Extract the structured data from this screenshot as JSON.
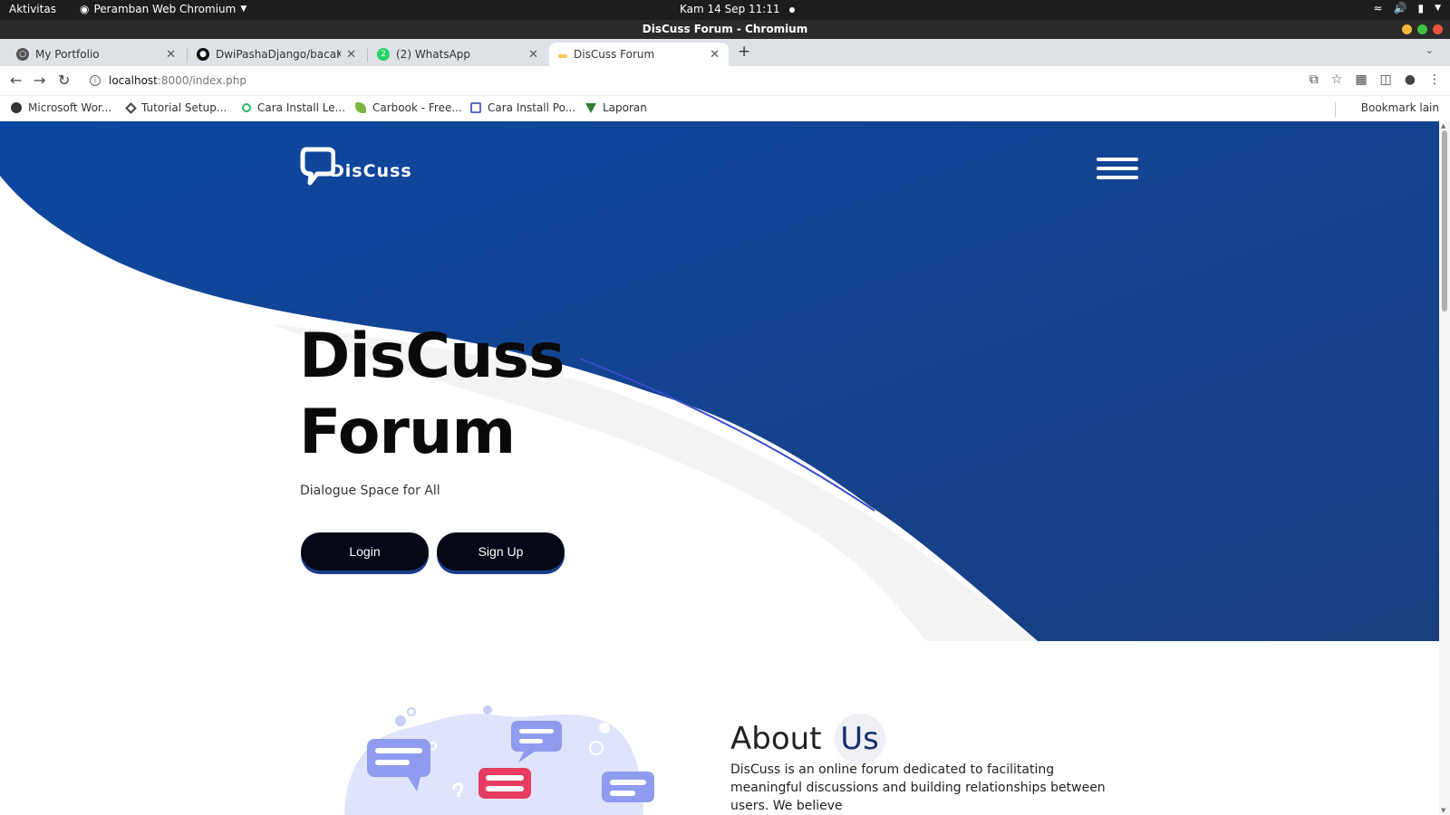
{
  "os": {
    "activities": "Aktivitas",
    "app_menu": "Peramban Web Chromium",
    "clock": "Kam 14 Sep  11:11"
  },
  "window": {
    "title": "DisCuss Forum - Chromium"
  },
  "tabs": [
    {
      "label": "My Portfolio"
    },
    {
      "label": "DwiPashaDjango/bacaKu"
    },
    {
      "label": "(2) WhatsApp"
    },
    {
      "label": "DisCuss Forum",
      "active": true
    }
  ],
  "address_bar": {
    "host": "localhost",
    "path": ":8000/index.php"
  },
  "bookmarks": [
    {
      "label": "Microsoft Wor..."
    },
    {
      "label": "Tutorial Setup..."
    },
    {
      "label": "Cara Install Le..."
    },
    {
      "label": "Carbook - Free..."
    },
    {
      "label": "Cara Install Po..."
    },
    {
      "label": "Laporan"
    }
  ],
  "bookmarks_folder": "Bookmark lain",
  "page": {
    "logo_text": "DisCuss",
    "hero_title_line1": "DisCuss",
    "hero_title_line2": "Forum",
    "hero_subtitle": "Dialogue Space for All",
    "login_button": "Login",
    "signup_button": "Sign Up",
    "about_title": "About",
    "about_title_highlight": "Us",
    "about_text": "DisCuss is an online forum dedicated to facilitating meaningful discussions and building relationships between users. We believe"
  },
  "colors": {
    "hero_blue": "#0d47a1",
    "hero_blue_dark": "#1a3f80",
    "button_bg": "#050815",
    "curve_gray": "#f3f2f5"
  }
}
